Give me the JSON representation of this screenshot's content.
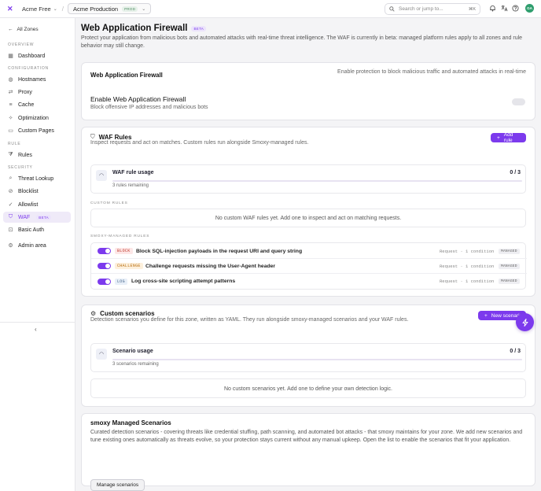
{
  "topbar": {
    "org": "Acme Free",
    "zone": "Acme Production",
    "zone_badge": "PROD",
    "search_placeholder": "Search or jump to...",
    "search_shortcut": "⌘K",
    "avatar_initials": "GA"
  },
  "sidebar": {
    "back_label": "All Zones",
    "sections": {
      "overview": "OVERVIEW",
      "configuration": "CONFIGURATION",
      "rule": "RULE",
      "security": "SECURITY"
    },
    "items": {
      "dashboard": "Dashboard",
      "hostnames": "Hostnames",
      "proxy": "Proxy",
      "cache": "Cache",
      "optimization": "Optimization",
      "custom_pages": "Custom Pages",
      "rules": "Rules",
      "threat_lookup": "Threat Lookup",
      "blocklist": "Blocklist",
      "allowlist": "Allowlist",
      "waf": "WAF",
      "waf_badge": "BETA",
      "basic_auth": "Basic Auth",
      "admin_area": "Admin area"
    }
  },
  "page": {
    "title": "Web Application Firewall",
    "title_badge": "BETA",
    "description": "Protect your application from malicious bots and automated attacks with real-time threat intelligence. The WAF is currently in beta: managed platform rules apply to all zones and rule behavior may still change."
  },
  "waf_card": {
    "title": "Web Application Firewall",
    "hint": "Enable protection to block malicious traffic and automated attacks in real-time",
    "enable_title": "Enable Web Application Firewall",
    "enable_desc": "Block offensive IP addresses and malicious bots",
    "enabled": false
  },
  "rules_card": {
    "title": "WAF Rules",
    "description": "Inspect requests and act on matches. Custom rules run alongside Smoxy-managed rules.",
    "add_button": "Add rule",
    "usage_title": "WAF rule usage",
    "usage_count": "0 / 3",
    "usage_fraction": 0,
    "usage_remaining": "3 rules remaining",
    "custom_label": "CUSTOM RULES",
    "custom_empty": "No custom WAF rules yet. Add one to inspect and act on matching requests.",
    "managed_label": "SMOXY-MANAGED RULES",
    "managed_rules": [
      {
        "action": "BLOCK",
        "name": "Block SQL-injection payloads in the request URI and query string",
        "meta": "Request · 1 condition",
        "badge": "MANAGED",
        "enabled": true
      },
      {
        "action": "CHALLENGE",
        "name": "Challenge requests missing the User-Agent header",
        "meta": "Request · 1 condition",
        "badge": "MANAGED",
        "enabled": true
      },
      {
        "action": "LOG",
        "name": "Log cross-site scripting attempt patterns",
        "meta": "Request · 1 condition",
        "badge": "MANAGED",
        "enabled": true
      }
    ]
  },
  "scenarios_card": {
    "title": "Custom scenarios",
    "description": "Detection scenarios you define for this zone, written as YAML. They run alongside smoxy-managed scenarios and your WAF rules.",
    "new_button": "New scenario",
    "usage_title": "Scenario usage",
    "usage_count": "0 / 3",
    "usage_fraction": 0,
    "usage_remaining": "3 scenarios remaining",
    "empty": "No custom scenarios yet. Add one to define your own detection logic."
  },
  "managed_card": {
    "title": "smoxy Managed Scenarios",
    "description": "Curated detection scenarios - covering threats like credential stuffing, path scanning, and automated bot attacks - that smoxy maintains for your zone. We add new scenarios and tune existing ones automatically as threats evolve, so your protection stays current without any manual upkeep. Open the list to enable the scenarios that fit your application.",
    "button": "Manage scenarios"
  },
  "icons": {
    "logo": "logo-icon",
    "bell": "bell-icon",
    "translate": "translate-icon",
    "help": "help-icon"
  },
  "colors": {
    "accent": "#7c3aed",
    "block": "#c0392b",
    "challenge": "#b86e10",
    "log": "#4a6a8f"
  }
}
